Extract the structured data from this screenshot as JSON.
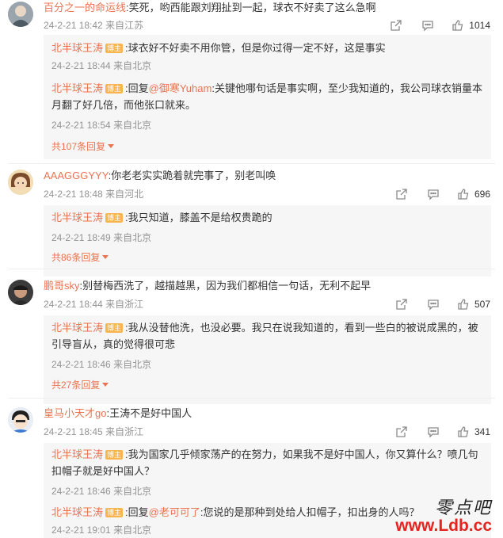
{
  "comments": [
    {
      "username": "百分之一的命运线",
      "text": ":笑死，哟西能跟刘翔扯到一起，球衣不好卖了这么急啊",
      "time": "24-2-21 18:42",
      "location": "来自江苏",
      "likes": "1014",
      "replies": [
        {
          "username": "北半球王涛",
          "badge": "博主",
          "mention": "",
          "text": ":球衣好不好卖不用你管，但是你过得一定不好，这是事实",
          "time": "24-2-21 18:44",
          "location": "来自北京"
        },
        {
          "username": "北半球王涛",
          "badge": "博主",
          "mention": "@御寒Yuham",
          "prefix": ":回复",
          "text": ":关键他哪句话是事实啊，至少我知道的，我公司球衣销量本月翻了好几倍，而他张口就来。",
          "time": "24-2-21 18:54",
          "location": "来自北京"
        }
      ],
      "more": "共107条回复"
    },
    {
      "username": "AAAGGGYYY",
      "text": ":你老老实实跪着就完事了，别老叫唤",
      "time": "24-2-21 18:48",
      "location": "来自河北",
      "likes": "696",
      "replies": [
        {
          "username": "北半球王涛",
          "badge": "博主",
          "mention": "",
          "text": ":我只知道，膝盖不是给权贵跪的",
          "time": "24-2-21 18:49",
          "location": "来自北京"
        }
      ],
      "more": "共86条回复"
    },
    {
      "username": "鹏哥sky",
      "text": ":别替梅西洗了，越描越黑，因为我们都相信一句话，无利不起早",
      "time": "24-2-21 18:44",
      "location": "来自浙江",
      "likes": "507",
      "replies": [
        {
          "username": "北半球王涛",
          "badge": "博主",
          "mention": "",
          "text": ":我从没替他洗，也没必要。我只在说我知道的，看到一些白的被说成黑的，被引导盲从，真的觉得很可悲",
          "time": "24-2-21 18:46",
          "location": "来自北京"
        }
      ],
      "more": "共27条回复"
    },
    {
      "username": "皇马小天才go",
      "text": ":王涛不是好中国人",
      "time": "24-2-21 18:45",
      "location": "来自浙江",
      "likes": "341",
      "replies": [
        {
          "username": "北半球王涛",
          "badge": "博主",
          "mention": "",
          "text": ":我为国家几乎倾家荡产的在努力，如果我不是好中国人，你又算什么？喷几句扣帽子就是好中国人？",
          "time": "24-2-21 18:46",
          "location": "来自北京"
        },
        {
          "username": "北半球王涛",
          "badge": "博主",
          "mention": "@老可可了",
          "prefix": ":回复",
          "text": ":您说的是那种到处给人扣帽子，扣出身的人吗？",
          "time": "24-2-21 19:01",
          "location": "来自北京"
        }
      ],
      "more": ""
    }
  ],
  "watermark": {
    "title": "零点吧",
    "url": "www.Ldb.cc"
  },
  "colors": {
    "username": "#eb7350",
    "badge": "#f9b54c",
    "reply_bg": "#f6f6f6",
    "meta": "#939393"
  }
}
